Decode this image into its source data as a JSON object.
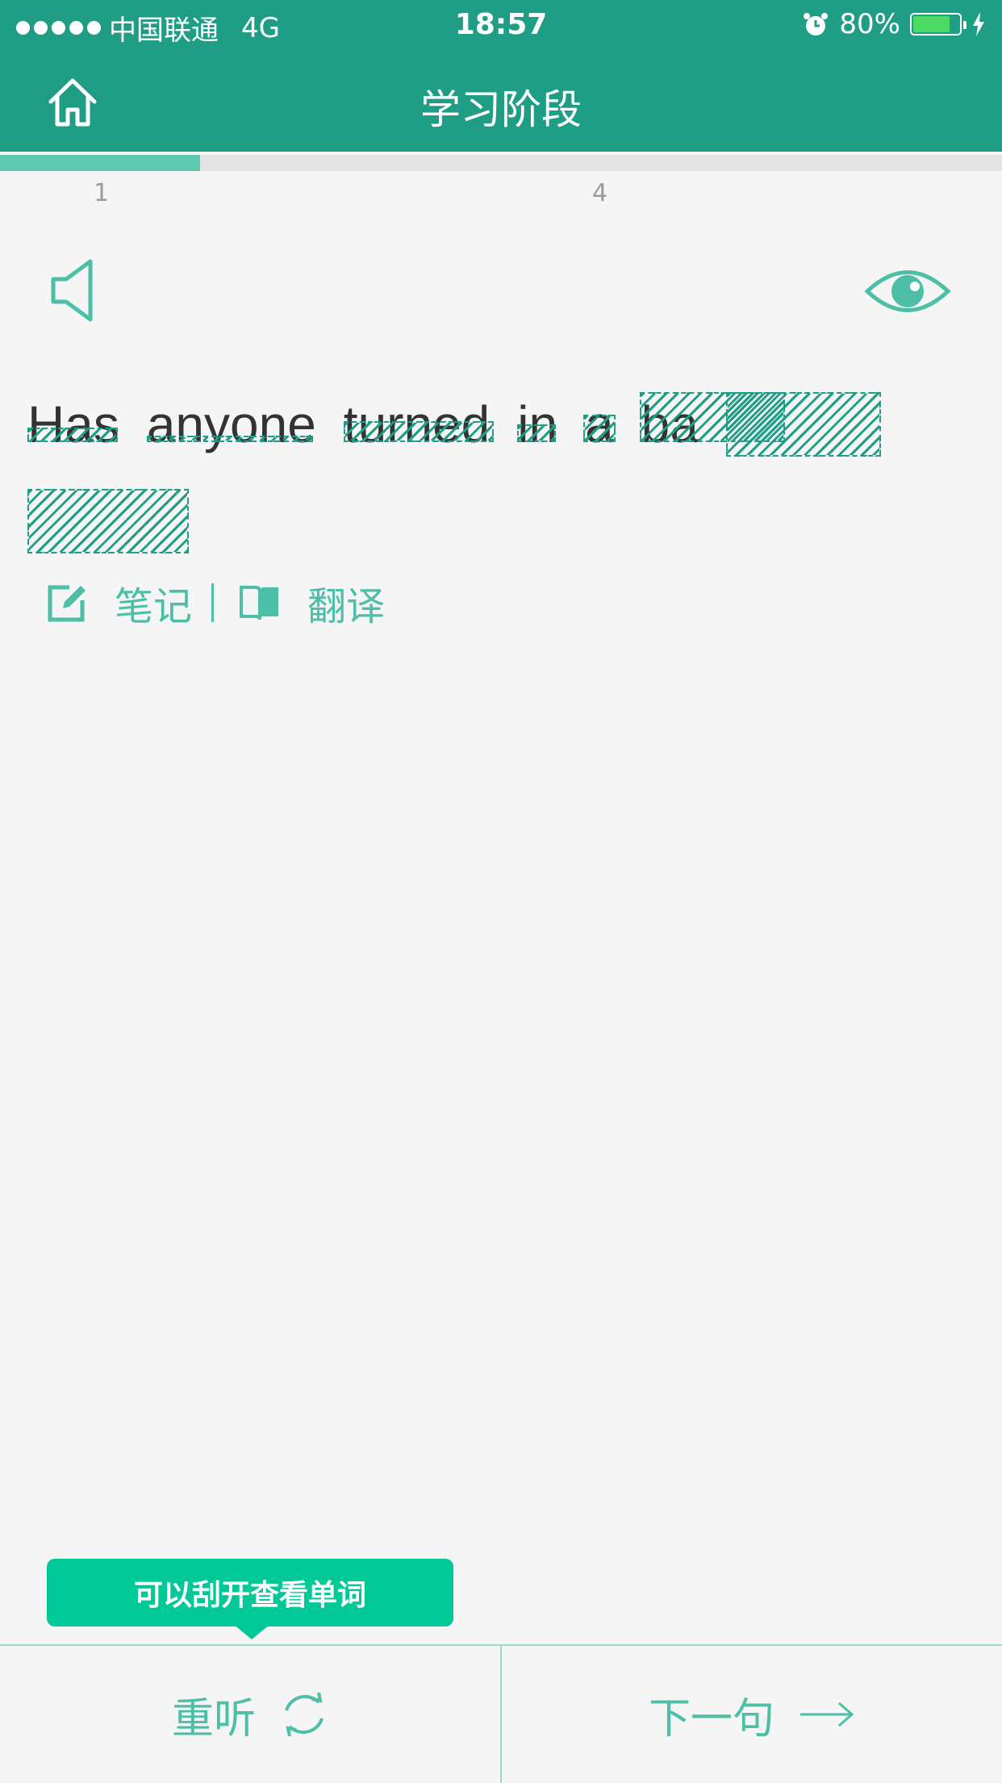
{
  "status_bar": {
    "carrier": "中国联通",
    "network": "4G",
    "time": "18:57",
    "battery": "80%",
    "battery_level": 0.8,
    "battery_color": "#4cd964",
    "signal_dots": 5
  },
  "header": {
    "title": "学习阶段",
    "home_icon": "home-icon",
    "background": "#1f9e85"
  },
  "progress": {
    "current_label": "1",
    "total_label": "4",
    "fraction": 0.2
  },
  "sentence": {
    "words": [
      {
        "text": "Has",
        "revealed": "Has"
      },
      {
        "text": "anyone",
        "revealed": "anyone"
      },
      {
        "text": "turned",
        "revealed": "turned"
      },
      {
        "text": "in",
        "revealed": "in"
      },
      {
        "text": "a",
        "revealed": "a"
      },
      {
        "text": "ba",
        "revealed": "ba"
      }
    ],
    "hidden_words": 2
  },
  "tools": {
    "notes_label": "笔记",
    "translate_label": "翻译"
  },
  "tooltip": {
    "text": "可以刮开查看单词"
  },
  "bottom": {
    "replay_label": "重听",
    "next_label": "下一句"
  },
  "colors": {
    "accent": "#4cbfa6",
    "tooltip": "#00c896"
  }
}
